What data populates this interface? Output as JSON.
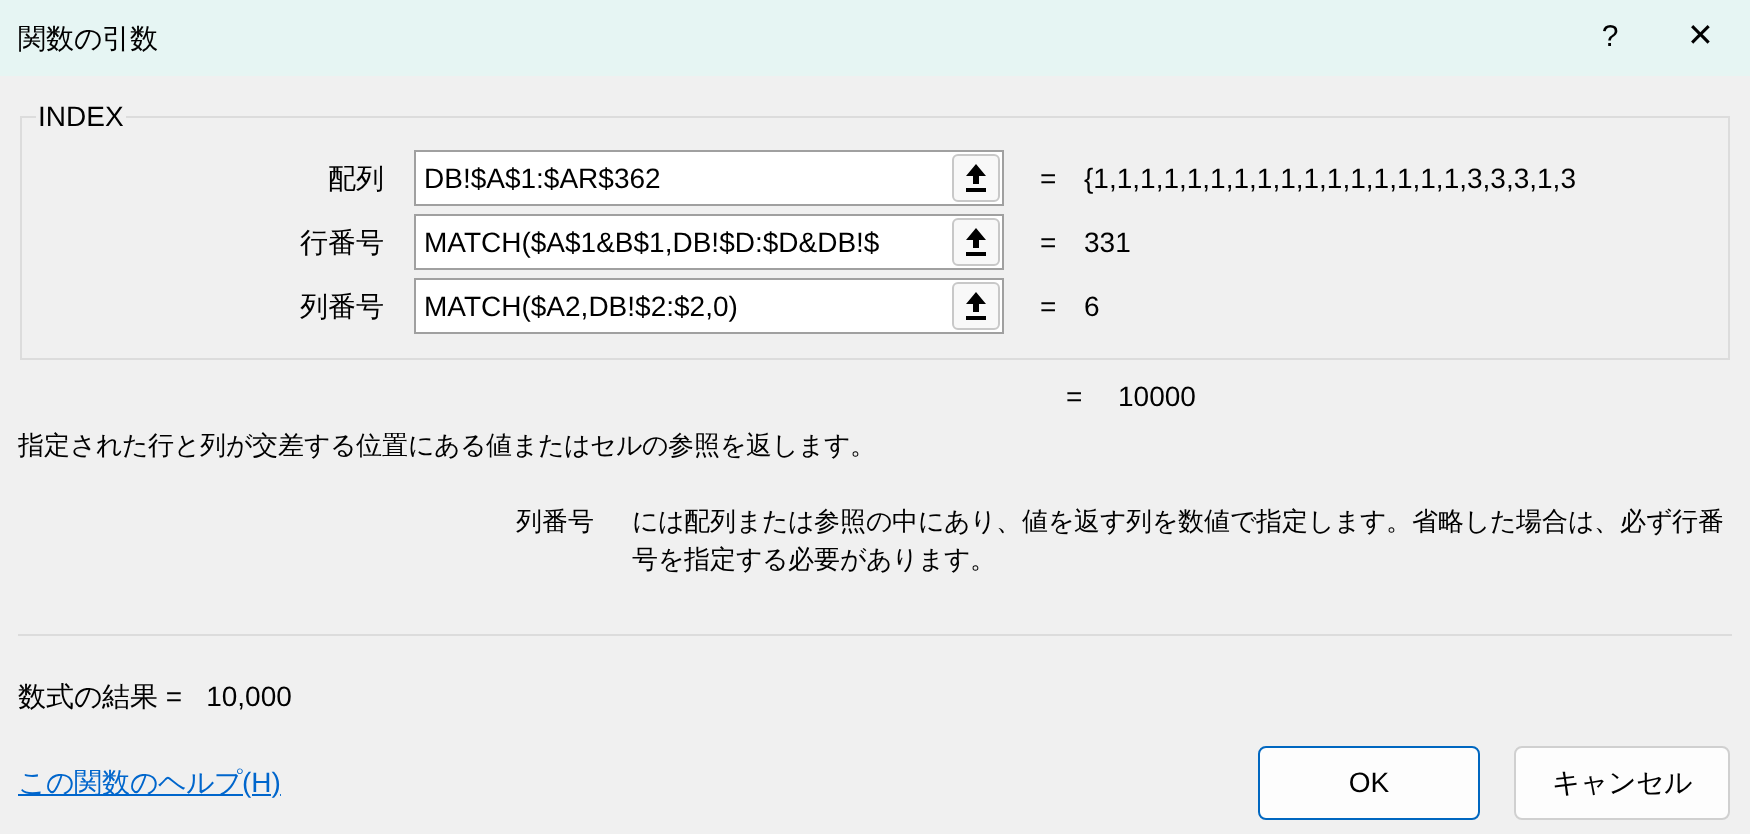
{
  "window": {
    "title": "関数の引数",
    "help_button": "?",
    "close_button": "✕"
  },
  "function_group": {
    "title": "INDEX",
    "arguments": [
      {
        "label": "配列",
        "value": "DB!$A$1:$AR$362",
        "equals": "=",
        "result": "{1,1,1,1,1,1,1,1,1,1,1,1,1,1,1,1,3,3,3,1,3"
      },
      {
        "label": "行番号",
        "value": "MATCH($A$1&B$1,DB!$D:$D&DB!$",
        "equals": "=",
        "result": "331"
      },
      {
        "label": "列番号",
        "value": "MATCH($A2,DB!$2:$2,0)",
        "equals": "=",
        "result": "6"
      }
    ]
  },
  "function_result": {
    "equals": "=",
    "value": "10000"
  },
  "function_description": "指定された行と列が交差する位置にある値またはセルの参照を返します。",
  "argument_help": {
    "name": "列番号",
    "text": "には配列または参照の中にあり、値を返す列を数値で指定します。省略した場合は、必ず行番号を指定する必要があります。"
  },
  "formula_result": {
    "label": "数式の結果 =",
    "value": "10,000"
  },
  "help_link": "この関数のヘルプ(H)",
  "buttons": [
    {
      "label": "OK",
      "default": true
    },
    {
      "label": "キャンセル",
      "default": false
    }
  ]
}
